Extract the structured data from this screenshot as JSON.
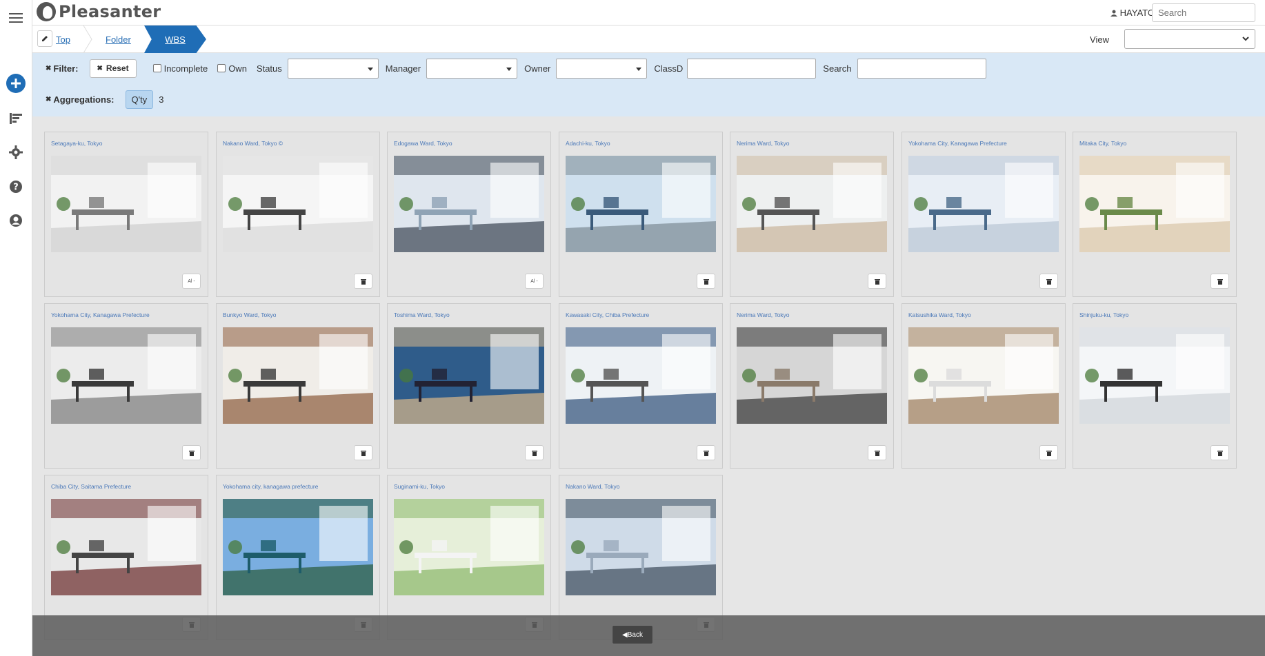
{
  "app": {
    "name": "Pleasanter"
  },
  "header": {
    "user": "HAYATO",
    "search_placeholder": "Search"
  },
  "rail": [
    "menu-icon",
    "add-icon",
    "sort-icon",
    "settings-icon",
    "help-icon",
    "account-icon"
  ],
  "breadcrumb": {
    "items": [
      "Top",
      "Folder"
    ],
    "active": "WBS"
  },
  "view": {
    "label": "View",
    "selected": ""
  },
  "filter": {
    "label": "Filter:",
    "reset": "Reset",
    "incomplete": "Incomplete",
    "own": "Own",
    "status": "Status",
    "manager": "Manager",
    "owner": "Owner",
    "classd": "ClassD",
    "search": "Search"
  },
  "aggregations": {
    "label": "Aggregations:",
    "qty_label": "Q'ty",
    "qty_value": "3"
  },
  "cards": [
    {
      "title": "Setagaya-ku, Tokyo",
      "btn": "Al -"
    },
    {
      "title": "Nakano Ward, Tokyo ©",
      "btn": "trash"
    },
    {
      "title": "Edogawa Ward, Tokyo",
      "btn": "Al -"
    },
    {
      "title": "Adachi-ku, Tokyo",
      "btn": "trash"
    },
    {
      "title": "Nerima Ward, Tokyo",
      "btn": "trash"
    },
    {
      "title": "Yokohama City, Kanagawa Prefecture",
      "btn": "trash"
    },
    {
      "title": "Mitaka City, Tokyo",
      "btn": "trash"
    },
    {
      "title": "Yokohama City, Kanagawa Prefecture",
      "btn": "trash"
    },
    {
      "title": "Bunkyo Ward, Tokyo",
      "btn": "trash"
    },
    {
      "title": "Toshima Ward, Tokyo",
      "btn": "trash"
    },
    {
      "title": "Kawasaki City, Chiba Prefecture",
      "btn": "trash"
    },
    {
      "title": "Nerima Ward, Tokyo",
      "btn": "trash"
    },
    {
      "title": "Katsushika Ward, Tokyo",
      "btn": "trash"
    },
    {
      "title": "Shinjuku-ku, Tokyo",
      "btn": "trash"
    },
    {
      "title": "Chiba City, Saitama Prefecture",
      "btn": "trash"
    },
    {
      "title": "Yokohama city, kanagawa prefecture",
      "btn": "trash"
    },
    {
      "title": "Suginami-ku, Tokyo",
      "btn": "trash"
    },
    {
      "title": "Nakano Ward, Tokyo",
      "btn": "trash"
    }
  ],
  "bottom": {
    "back": "◀Back"
  },
  "colors": {
    "accent": "#1f6db6",
    "filter_bg": "#d9e8f6",
    "link": "#2a6fb5"
  }
}
